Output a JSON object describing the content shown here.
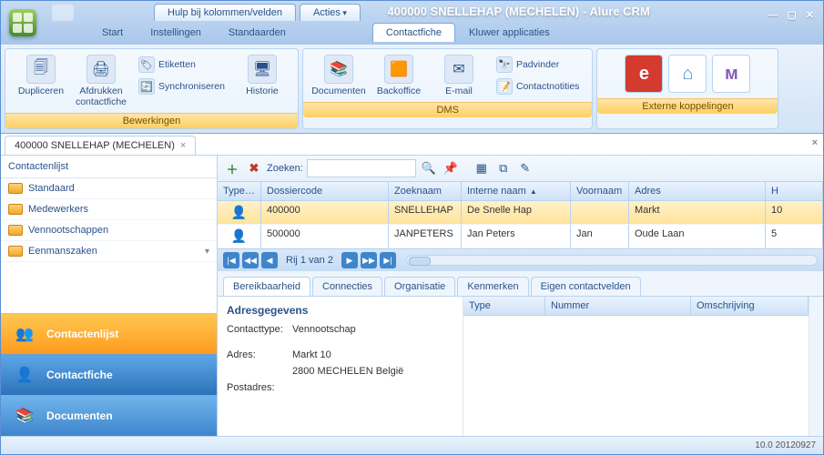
{
  "app_title": "400000 SNELLEHAP (MECHELEN) - Alure CRM",
  "context_tabs": {
    "help": "Hulp bij kolommen/velden",
    "actions": "Acties"
  },
  "menu_tabs": [
    "Start",
    "Instellingen",
    "Standaarden",
    "Contactfiche",
    "Kluwer applicaties"
  ],
  "menu_active": 3,
  "ribbon": {
    "g1": {
      "title": "Bewerkingen",
      "dupliceren": "Dupliceren",
      "afdrukken": "Afdrukken contactfiche",
      "etiketten": "Etiketten",
      "synchroniseren": "Synchroniseren",
      "historie": "Historie"
    },
    "g2": {
      "title": "DMS",
      "documenten": "Documenten",
      "backoffice": "Backoffice",
      "email": "E-mail",
      "padvinder": "Padvinder",
      "contactnotities": "Contactnotities"
    },
    "g3": {
      "title": "Externe koppelingen"
    }
  },
  "doc_tab": "400000 SNELLEHAP (MECHELEN)",
  "sidebar": {
    "heading": "Contactenlijst",
    "items": [
      "Standaard",
      "Medewerkers",
      "Vennootschappen",
      "Eenmanszaken"
    ]
  },
  "nav": {
    "contactenlijst": "Contactenlijst",
    "contactfiche": "Contactfiche",
    "documenten": "Documenten"
  },
  "toolbar": {
    "search_label": "Zoeken:",
    "search_value": ""
  },
  "grid": {
    "cols": {
      "typering": "Typering",
      "dossiercode": "Dossiercode",
      "zoeknaam": "Zoeknaam",
      "interne_naam": "Interne naam",
      "voornaam": "Voornaam",
      "adres": "Adres",
      "h": "H"
    },
    "rows": [
      {
        "dossiercode": "400000",
        "zoeknaam": "SNELLEHAP",
        "interne_naam": "De Snelle Hap",
        "voornaam": "",
        "adres": "Markt",
        "h": "10"
      },
      {
        "dossiercode": "500000",
        "zoeknaam": "JANPETERS",
        "interne_naam": "Jan Peters",
        "voornaam": "Jan",
        "adres": "Oude Laan",
        "h": "5"
      }
    ]
  },
  "pager": {
    "text": "Rij 1 van 2"
  },
  "subtabs": [
    "Bereikbaarheid",
    "Connecties",
    "Organisatie",
    "Kenmerken",
    "Eigen contactvelden"
  ],
  "subtab_active": 0,
  "detail": {
    "heading": "Adresgegevens",
    "contacttype_label": "Contacttype:",
    "contacttype": "Vennootschap",
    "adres_label": "Adres:",
    "adres_line1": "Markt 10",
    "adres_line2": "2800 MECHELEN België",
    "postadres_label": "Postadres:"
  },
  "detail_cols": {
    "type": "Type",
    "nummer": "Nummer",
    "omschrijving": "Omschrijving"
  },
  "status": "10.0 20120927"
}
